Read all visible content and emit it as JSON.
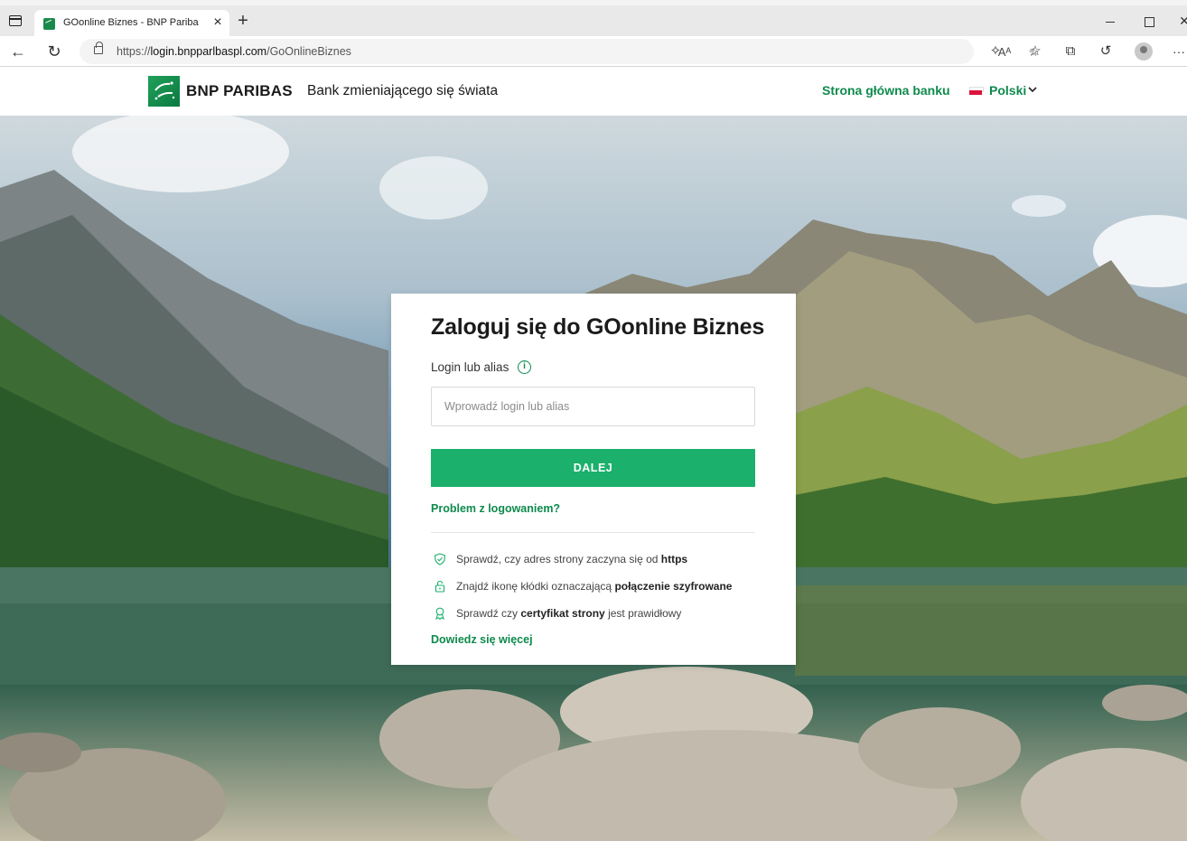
{
  "browser": {
    "tab_title": "GOonline Biznes - BNP Paribas B",
    "url_prefix": "https://",
    "url_domain": "login.bnpparlbaspl.com",
    "url_path": "/GoOnlineBiznes",
    "read_aloud_glyph": "Aᴬ"
  },
  "header": {
    "brand": "BNP PARIBAS",
    "tagline": "Bank zmieniającego się świata",
    "home_link": "Strona główna banku",
    "language": "Polski"
  },
  "login": {
    "title": "Zaloguj się do GOonline Biznes",
    "field_label": "Login lub alias",
    "info_glyph": "i",
    "input_placeholder": "Wprowadź login lub alias",
    "input_value": "",
    "submit_label": "DALEJ",
    "problem_link": "Problem z logowaniem?",
    "tips": [
      {
        "pre": "Sprawdź, czy adres strony zaczyna się od ",
        "bold": "https",
        "post": ""
      },
      {
        "pre": "Znajdź ikonę kłódki oznaczającą ",
        "bold": "połączenie szyfrowane",
        "post": ""
      },
      {
        "pre": "Sprawdź czy ",
        "bold": "certyfikat strony",
        "post": " jest prawidłowy"
      }
    ],
    "learn_more": "Dowiedz się więcej"
  },
  "colors": {
    "brand_green": "#0e8a4d",
    "button_green": "#1bb06c",
    "flag_red": "#dc143c"
  }
}
